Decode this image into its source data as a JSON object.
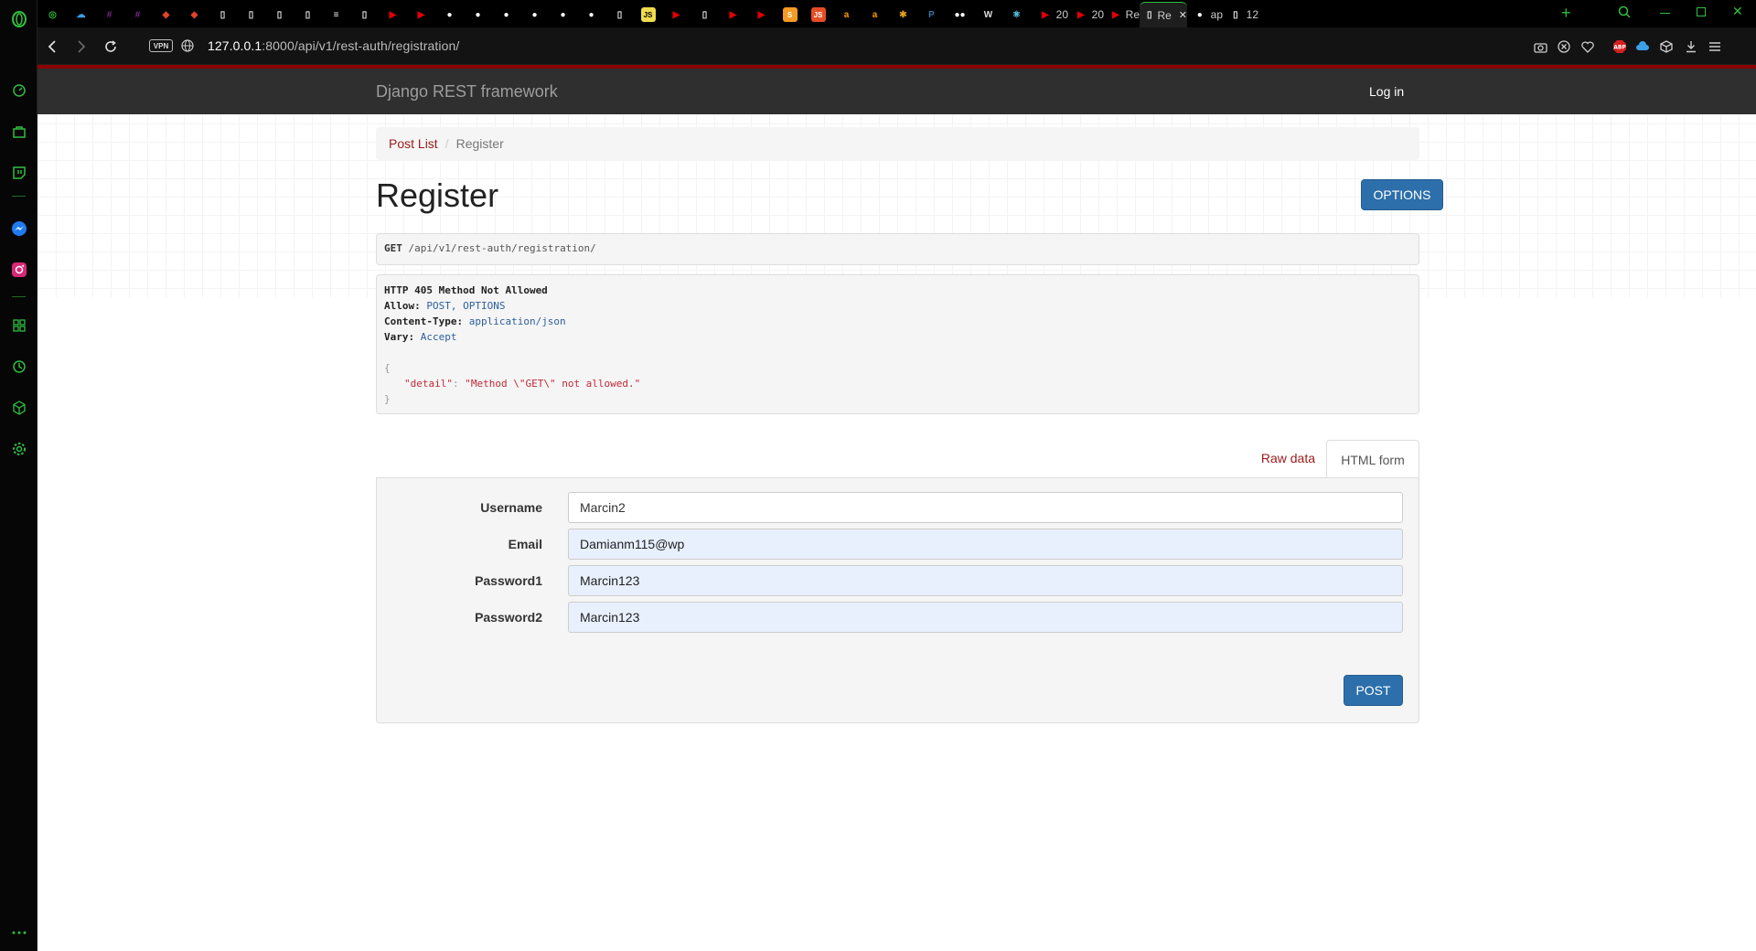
{
  "browser": {
    "tabs": [
      {
        "icon": "gamepad-icon",
        "color": "#2fbf3f"
      },
      {
        "icon": "cloud-icon",
        "color": "#3ba0e8"
      },
      {
        "icon": "slack-icon",
        "color": "#7a2a8c"
      },
      {
        "icon": "slack-icon",
        "color": "#7a2a8c"
      },
      {
        "icon": "gitlab-icon",
        "color": "#e24329"
      },
      {
        "icon": "gitlab-icon",
        "color": "#e24329"
      },
      {
        "icon": "document-icon",
        "color": "#eeeeee"
      },
      {
        "icon": "document-icon",
        "color": "#eeeeee"
      },
      {
        "icon": "document-icon",
        "color": "#eeeeee"
      },
      {
        "icon": "document-icon",
        "color": "#eeeeee"
      },
      {
        "icon": "stackoverflow-icon",
        "color": "#eeeeee"
      },
      {
        "icon": "document-icon",
        "color": "#eeeeee"
      },
      {
        "icon": "youtube-icon",
        "color": "#e00000"
      },
      {
        "icon": "youtube-icon",
        "color": "#e00000"
      },
      {
        "icon": "github-icon",
        "color": "#ffffff"
      },
      {
        "icon": "github-icon",
        "color": "#ffffff"
      },
      {
        "icon": "github-icon",
        "color": "#ffffff"
      },
      {
        "icon": "github-icon",
        "color": "#ffffff"
      },
      {
        "icon": "github-icon",
        "color": "#ffffff"
      },
      {
        "icon": "github-icon",
        "color": "#ffffff"
      },
      {
        "icon": "document-icon",
        "color": "#eeeeee"
      },
      {
        "icon": "js-icon",
        "color": "#f0db4f"
      },
      {
        "icon": "youtube-icon",
        "color": "#e00000"
      },
      {
        "icon": "document-icon",
        "color": "#eeeeee"
      },
      {
        "icon": "youtube-icon",
        "color": "#e00000"
      },
      {
        "icon": "youtube-icon",
        "color": "#e00000"
      },
      {
        "icon": "sublime-icon",
        "color": "#f59a23"
      },
      {
        "icon": "js-red-icon",
        "color": "#e44d26"
      },
      {
        "icon": "amazon-icon",
        "color": "#ff9900"
      },
      {
        "icon": "amazon-icon",
        "color": "#ff9900"
      },
      {
        "icon": "bee-icon",
        "color": "#e0a020"
      },
      {
        "icon": "python-icon",
        "color": "#3b77a8"
      },
      {
        "icon": "medium-icon",
        "color": "#ffffff"
      },
      {
        "icon": "wiki-icon",
        "color": "#dddddd"
      },
      {
        "icon": "react-icon",
        "color": "#61dafb"
      }
    ],
    "labeled_tabs": [
      {
        "icon": "youtube-icon",
        "color": "#e00000",
        "label": "20"
      },
      {
        "icon": "youtube-icon",
        "color": "#e00000",
        "label": "20"
      },
      {
        "icon": "youtube-icon",
        "color": "#e00000",
        "label": "Re"
      },
      {
        "icon": "document-icon",
        "color": "#eeeeee",
        "label": "Re"
      },
      {
        "icon": "github-icon",
        "color": "#ffffff",
        "label": "ap"
      },
      {
        "icon": "document-icon",
        "color": "#eeeeee",
        "label": "12"
      }
    ],
    "vpn_label": "VPN",
    "url_host": "127.0.0.1",
    "url_rest": ":8000/api/v1/rest-auth/registration/",
    "accent": "#2fbf3f"
  },
  "navbar": {
    "brand": "Django REST framework",
    "login": "Log in"
  },
  "breadcrumb": {
    "items": [
      "Post List",
      "Register"
    ],
    "separator": "/"
  },
  "page_title": "Register",
  "options_button": "OPTIONS",
  "request": {
    "method": "GET",
    "path": "/api/v1/rest-auth/registration/"
  },
  "response": {
    "status": "HTTP 405 Method Not Allowed",
    "headers": [
      {
        "key": "Allow:",
        "value": "POST, OPTIONS"
      },
      {
        "key": "Content-Type:",
        "value": "application/json"
      },
      {
        "key": "Vary:",
        "value": "Accept"
      }
    ],
    "open_brace": "{",
    "body_key": "\"detail\"",
    "body_colon": ": ",
    "body_value": "\"Method \\\"GET\\\" not allowed.\"",
    "close_brace": "}"
  },
  "content_tabs": {
    "raw": "Raw data",
    "html": "HTML form"
  },
  "form": {
    "fields": [
      {
        "label": "Username",
        "value": "Marcin2"
      },
      {
        "label": "Email",
        "value": "Damianm115@wp"
      },
      {
        "label": "Password1",
        "value": "Marcin123"
      },
      {
        "label": "Password2",
        "value": "Marcin123"
      }
    ],
    "submit": "POST"
  }
}
